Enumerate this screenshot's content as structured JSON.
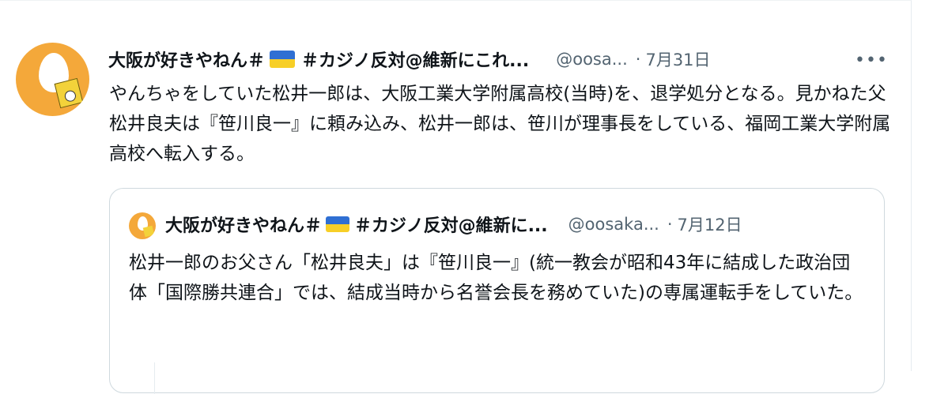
{
  "tweet": {
    "display_name": "大阪が好きやねん＃",
    "display_name_suffix": "＃カジノ反対@維新にこれ...",
    "handle": "@oosa...",
    "separator": "·",
    "date": "7月31日",
    "more_label": "•••",
    "text": "やんちゃをしていた松井一郎は、大阪工業大学附属高校(当時)を、退学処分となる。見かねた父松井良夫は『笹川良一』に頼み込み、松井一郎は、笹川が理事長をしている、福岡工業大学附属高校へ転入する。"
  },
  "quote": {
    "display_name": "大阪が好きやねん＃",
    "display_name_suffix": "＃カジノ反対@維新に...",
    "handle": "@oosaka...",
    "separator": "·",
    "date": "7月12日",
    "text": "松井一郎のお父さん「松井良夫」は『笹川良一』(統一教会が昭和43年に結成した政治団体「国際勝共連合」では、結成当時から名誉会長を務めていた)の専属運転手をしていた。"
  },
  "icons": {
    "avatar": "avatar-egg-icon",
    "flag": "ukraine-flag-icon",
    "more": "more-options-icon"
  },
  "colors": {
    "text_primary": "#0f1419",
    "text_secondary": "#536471",
    "border": "#cfd9de",
    "avatar_bg": "#f4a83a",
    "flag_blue": "#2f6fd3",
    "flag_yellow": "#f7cf27"
  }
}
